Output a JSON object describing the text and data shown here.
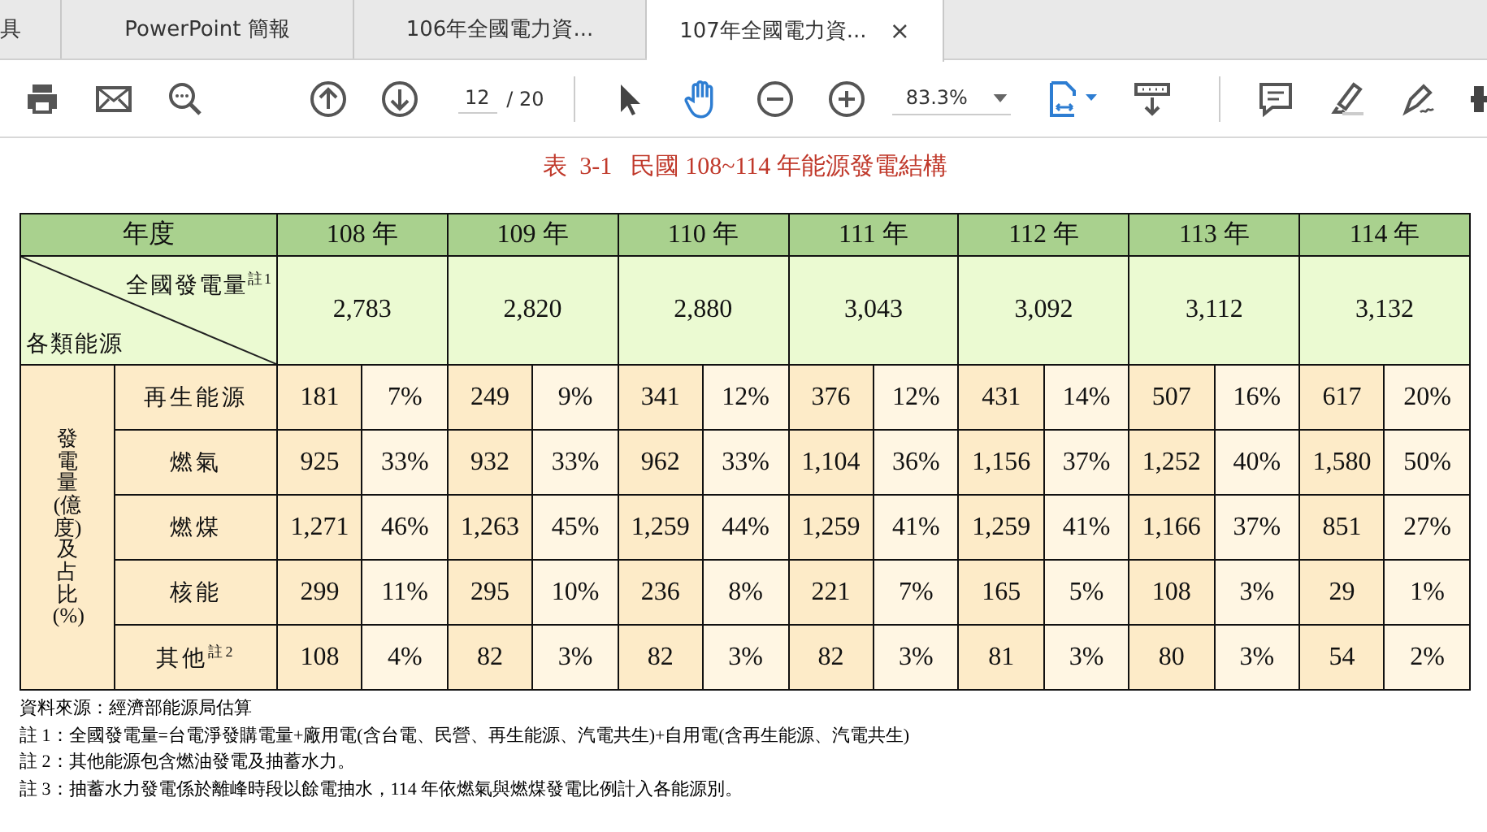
{
  "tabs": [
    {
      "label": "具",
      "selected": false
    },
    {
      "label": "PowerPoint 簡報",
      "selected": false
    },
    {
      "label": "106年全國電力資...",
      "selected": false
    },
    {
      "label": "107年全國電力資...",
      "selected": true,
      "close": "×"
    }
  ],
  "toolbar": {
    "page": "12",
    "page_total": "/ 20",
    "zoom": "83.3%",
    "tools": [
      {
        "kind": "select",
        "selected": false
      },
      {
        "kind": "hand",
        "selected": true
      }
    ]
  },
  "document": {
    "title": "表  3-1   民國 108~114 年能源發電結構",
    "table": {
      "corner_header": "年度",
      "total_label": "全國發電量$^{註1}$",
      "category_label": "各類能源",
      "side_label": "發電量(億度)及占比(%)",
      "years": [
        "108 年",
        "109 年",
        "110 年",
        "111 年",
        "112 年",
        "113 年",
        "114 年"
      ],
      "totals": [
        "2,783",
        "2,820",
        "2,880",
        "3,043",
        "3,092",
        "3,112",
        "3,132"
      ],
      "rows": [
        {
          "source": "再生能源",
          "values": [
            [
              "181",
              "7%"
            ],
            [
              "249",
              "9%"
            ],
            [
              "341",
              "12%"
            ],
            [
              "376",
              "12%"
            ],
            [
              "431",
              "14%"
            ],
            [
              "507",
              "16%"
            ],
            [
              "617",
              "20%"
            ]
          ]
        },
        {
          "source": "燃氣",
          "values": [
            [
              "925",
              "33%"
            ],
            [
              "932",
              "33%"
            ],
            [
              "962",
              "33%"
            ],
            [
              "1,104",
              "36%"
            ],
            [
              "1,156",
              "37%"
            ],
            [
              "1,252",
              "40%"
            ],
            [
              "1,580",
              "50%"
            ]
          ]
        },
        {
          "source": "燃煤",
          "values": [
            [
              "1,271",
              "46%"
            ],
            [
              "1,263",
              "45%"
            ],
            [
              "1,259",
              "44%"
            ],
            [
              "1,259",
              "41%"
            ],
            [
              "1,259",
              "41%"
            ],
            [
              "1,166",
              "37%"
            ],
            [
              "851",
              "27%"
            ]
          ]
        },
        {
          "source": "核能",
          "values": [
            [
              "299",
              "11%"
            ],
            [
              "295",
              "10%"
            ],
            [
              "236",
              "8%"
            ],
            [
              "221",
              "7%"
            ],
            [
              "165",
              "5%"
            ],
            [
              "108",
              "3%"
            ],
            [
              "29",
              "1%"
            ]
          ]
        },
        {
          "source": "其他$^{註2}$",
          "values": [
            [
              "108",
              "4%"
            ],
            [
              "82",
              "3%"
            ],
            [
              "82",
              "3%"
            ],
            [
              "82",
              "3%"
            ],
            [
              "81",
              "3%"
            ],
            [
              "80",
              "3%"
            ],
            [
              "54",
              "2%"
            ]
          ]
        }
      ]
    },
    "notes": [
      "資料來源：經濟部能源局估算",
      "註 1：全國發電量=台電淨發購電量+廠用電(含台電、民營、再生能源、汽電共生)+自用電(含再生能源、汽電共生)",
      "註 2：其他能源包含燃油發電及抽蓄水力。",
      "註 3：抽蓄水力發電係於離峰時段以餘電抽水，114 年依燃氣與燃煤發電比例計入各能源別。"
    ]
  }
}
